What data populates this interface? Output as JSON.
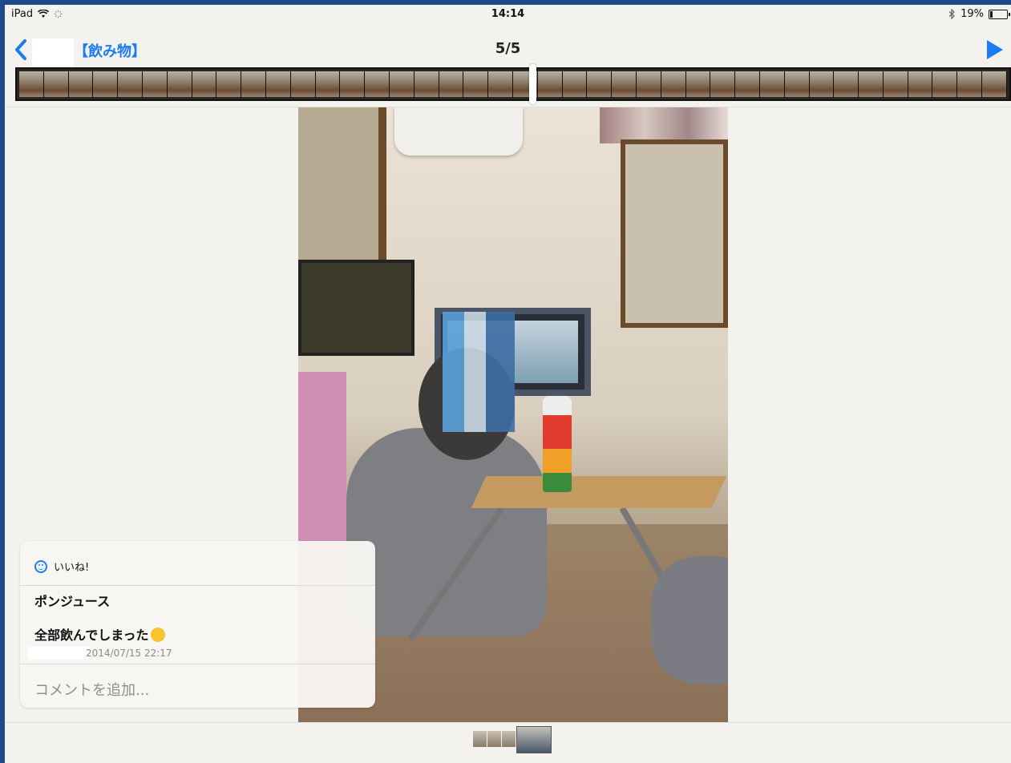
{
  "status_bar": {
    "device": "iPad",
    "time": "14:14",
    "battery": "19%",
    "battery_level": 0.19
  },
  "nav": {
    "album_title": "【飲み物】",
    "counter": "5/5"
  },
  "filmstrip": {
    "frame_count": 40
  },
  "comment_panel": {
    "like_label": "いいね!",
    "title": "ポンジュース",
    "body": "全部飲んでしまった",
    "timestamp": "2014/07/15 22:17",
    "add_comment_placeholder": "コメントを追加..."
  },
  "bottom_thumbs": {
    "count": 4,
    "selected_index": 3
  },
  "icons": {
    "back": "chevron-left-icon",
    "play": "play-icon",
    "wifi": "wifi-icon",
    "bluetooth": "bluetooth-icon",
    "like": "smiley-icon"
  },
  "colors": {
    "accent": "#1a7cf0",
    "frame_border": "#1f4a8a"
  }
}
